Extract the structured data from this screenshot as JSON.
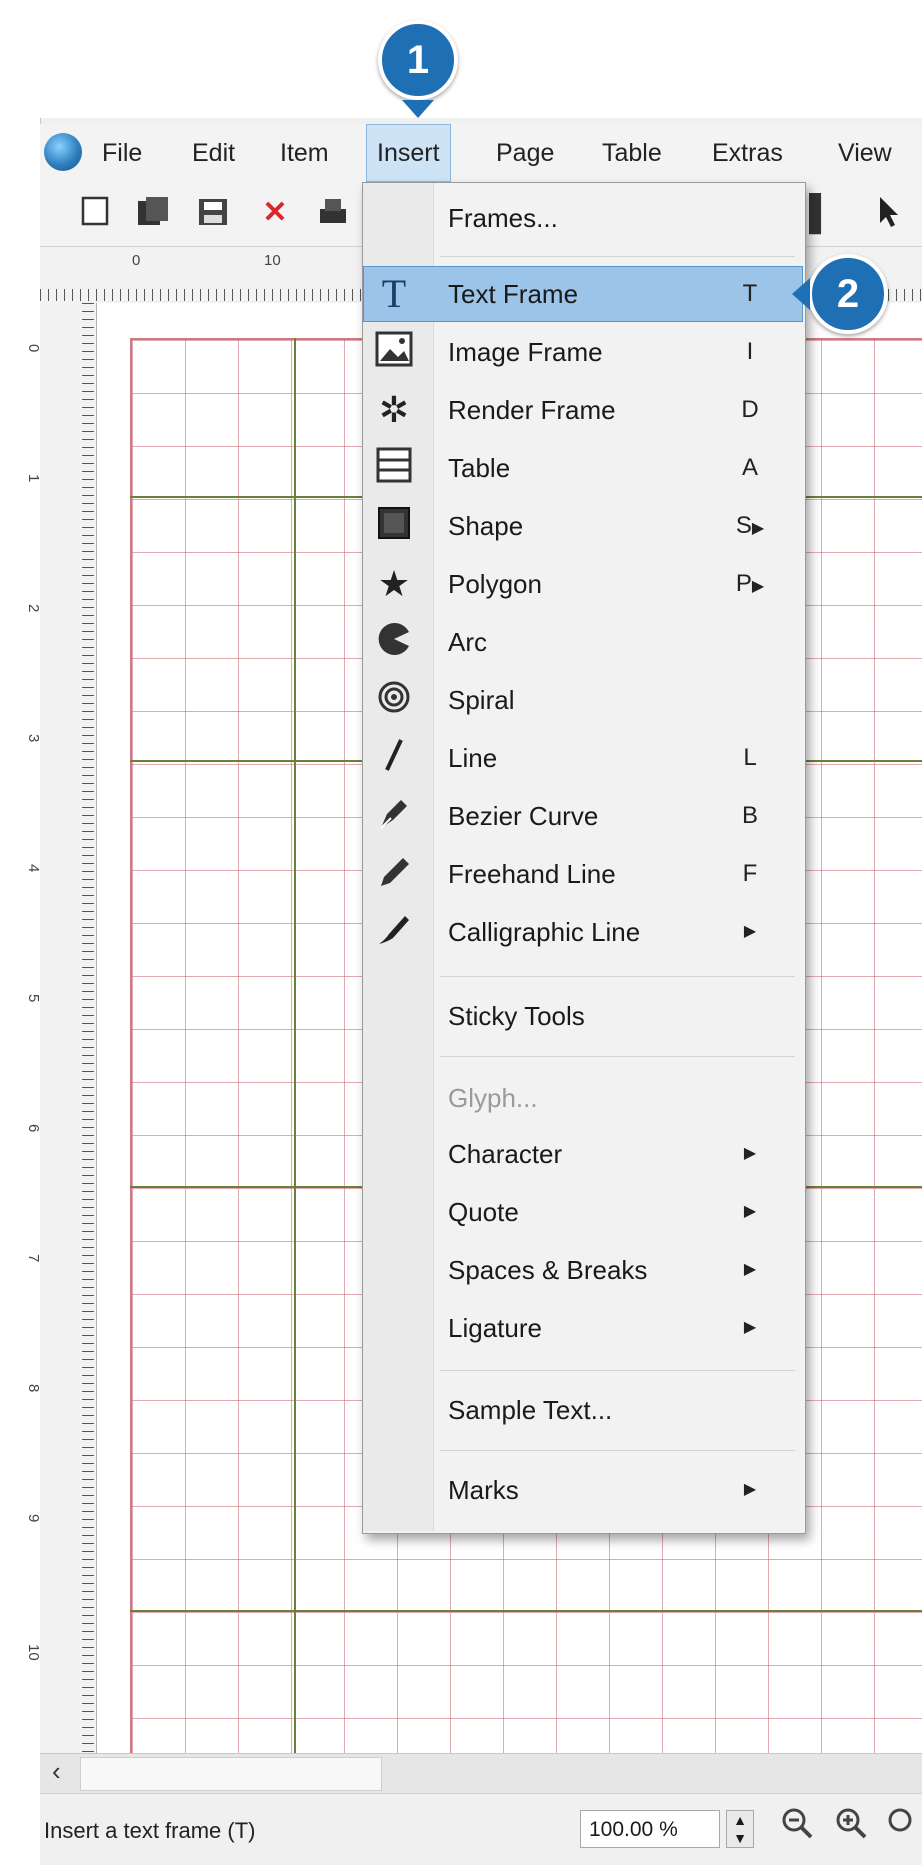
{
  "menubar": {
    "items": [
      {
        "label": "File"
      },
      {
        "label": "Edit"
      },
      {
        "label": "Item"
      },
      {
        "label": "Insert"
      },
      {
        "label": "Page"
      },
      {
        "label": "Table"
      },
      {
        "label": "Extras"
      },
      {
        "label": "View"
      }
    ],
    "active": "Insert"
  },
  "toolbar": {
    "icons": [
      "new-document-icon",
      "open-icon",
      "save-icon",
      "close-icon",
      "print-icon",
      "select-arrow-icon"
    ]
  },
  "ruler": {
    "horizontal": [
      "0",
      "10"
    ],
    "vertical": [
      "0",
      "1",
      "2",
      "3",
      "4",
      "5",
      "6",
      "7",
      "8",
      "9",
      "10"
    ]
  },
  "insert_menu": {
    "items": [
      {
        "label": "Frames...",
        "icon": "",
        "shortcut": "",
        "submenu": false
      },
      {
        "label": "Text Frame",
        "icon": "text-frame-icon",
        "shortcut": "T",
        "submenu": false,
        "highlighted": true
      },
      {
        "label": "Image Frame",
        "icon": "image-frame-icon",
        "shortcut": "I",
        "submenu": false
      },
      {
        "label": "Render Frame",
        "icon": "render-frame-icon",
        "shortcut": "D",
        "submenu": false
      },
      {
        "label": "Table",
        "icon": "table-icon",
        "shortcut": "A",
        "submenu": false
      },
      {
        "label": "Shape",
        "icon": "shape-icon",
        "shortcut": "S",
        "submenu": true
      },
      {
        "label": "Polygon",
        "icon": "star-polygon-icon",
        "shortcut": "P",
        "submenu": true
      },
      {
        "label": "Arc",
        "icon": "arc-icon",
        "shortcut": "",
        "submenu": false
      },
      {
        "label": "Spiral",
        "icon": "spiral-icon",
        "shortcut": "",
        "submenu": false
      },
      {
        "label": "Line",
        "icon": "line-icon",
        "shortcut": "L",
        "submenu": false
      },
      {
        "label": "Bezier Curve",
        "icon": "bezier-pen-icon",
        "shortcut": "B",
        "submenu": false
      },
      {
        "label": "Freehand Line",
        "icon": "pencil-icon",
        "shortcut": "F",
        "submenu": false
      },
      {
        "label": "Calligraphic Line",
        "icon": "calligraphy-pen-icon",
        "shortcut": "",
        "submenu": true
      },
      {
        "label": "Sticky Tools",
        "icon": "",
        "shortcut": "",
        "submenu": false
      },
      {
        "label": "Glyph...",
        "icon": "",
        "shortcut": "",
        "submenu": false,
        "disabled": true
      },
      {
        "label": "Character",
        "icon": "",
        "shortcut": "",
        "submenu": true
      },
      {
        "label": "Quote",
        "icon": "",
        "shortcut": "",
        "submenu": true
      },
      {
        "label": "Spaces & Breaks",
        "icon": "",
        "shortcut": "",
        "submenu": true
      },
      {
        "label": "Ligature",
        "icon": "",
        "shortcut": "",
        "submenu": true
      },
      {
        "label": "Sample Text...",
        "icon": "",
        "shortcut": "",
        "submenu": false
      },
      {
        "label": "Marks",
        "icon": "",
        "shortcut": "",
        "submenu": true
      }
    ]
  },
  "callouts": [
    "1",
    "2"
  ],
  "status": {
    "text": "Insert a text frame (T)",
    "zoom": "100.00 %"
  },
  "colors": {
    "accent": "#1f6fb4",
    "highlight": "#9cc3e8",
    "grid": "#c86470",
    "guide": "#6c7f3c"
  }
}
